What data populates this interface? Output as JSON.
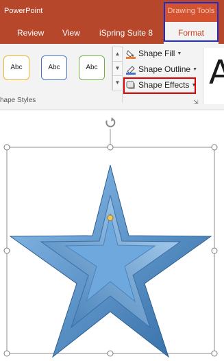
{
  "app": {
    "title": "PowerPoint"
  },
  "context": {
    "header": "Drawing Tools"
  },
  "tabs": {
    "review": "Review",
    "view": "View",
    "ispring": "iSpring Suite 8",
    "format": "Format"
  },
  "shape_styles": {
    "tiles": [
      "Abc",
      "Abc",
      "Abc"
    ],
    "group_label": "hape Styles"
  },
  "commands": {
    "shape_fill": "Shape Fill",
    "shape_outline": "Shape Outline",
    "shape_effects": "Shape Effects"
  },
  "wordart": {
    "glyph": "A"
  },
  "colors": {
    "title_bar": "#b7472a",
    "format_tab_text": "#c43e1c",
    "highlight_blue": "#1f2bd1",
    "highlight_red": "#e00000",
    "star_fill": "#5b9bd5"
  },
  "icons": [
    "shape-fill-icon",
    "shape-outline-icon",
    "shape-effects-icon",
    "rotate-handle-icon",
    "dialog-launcher-icon"
  ]
}
